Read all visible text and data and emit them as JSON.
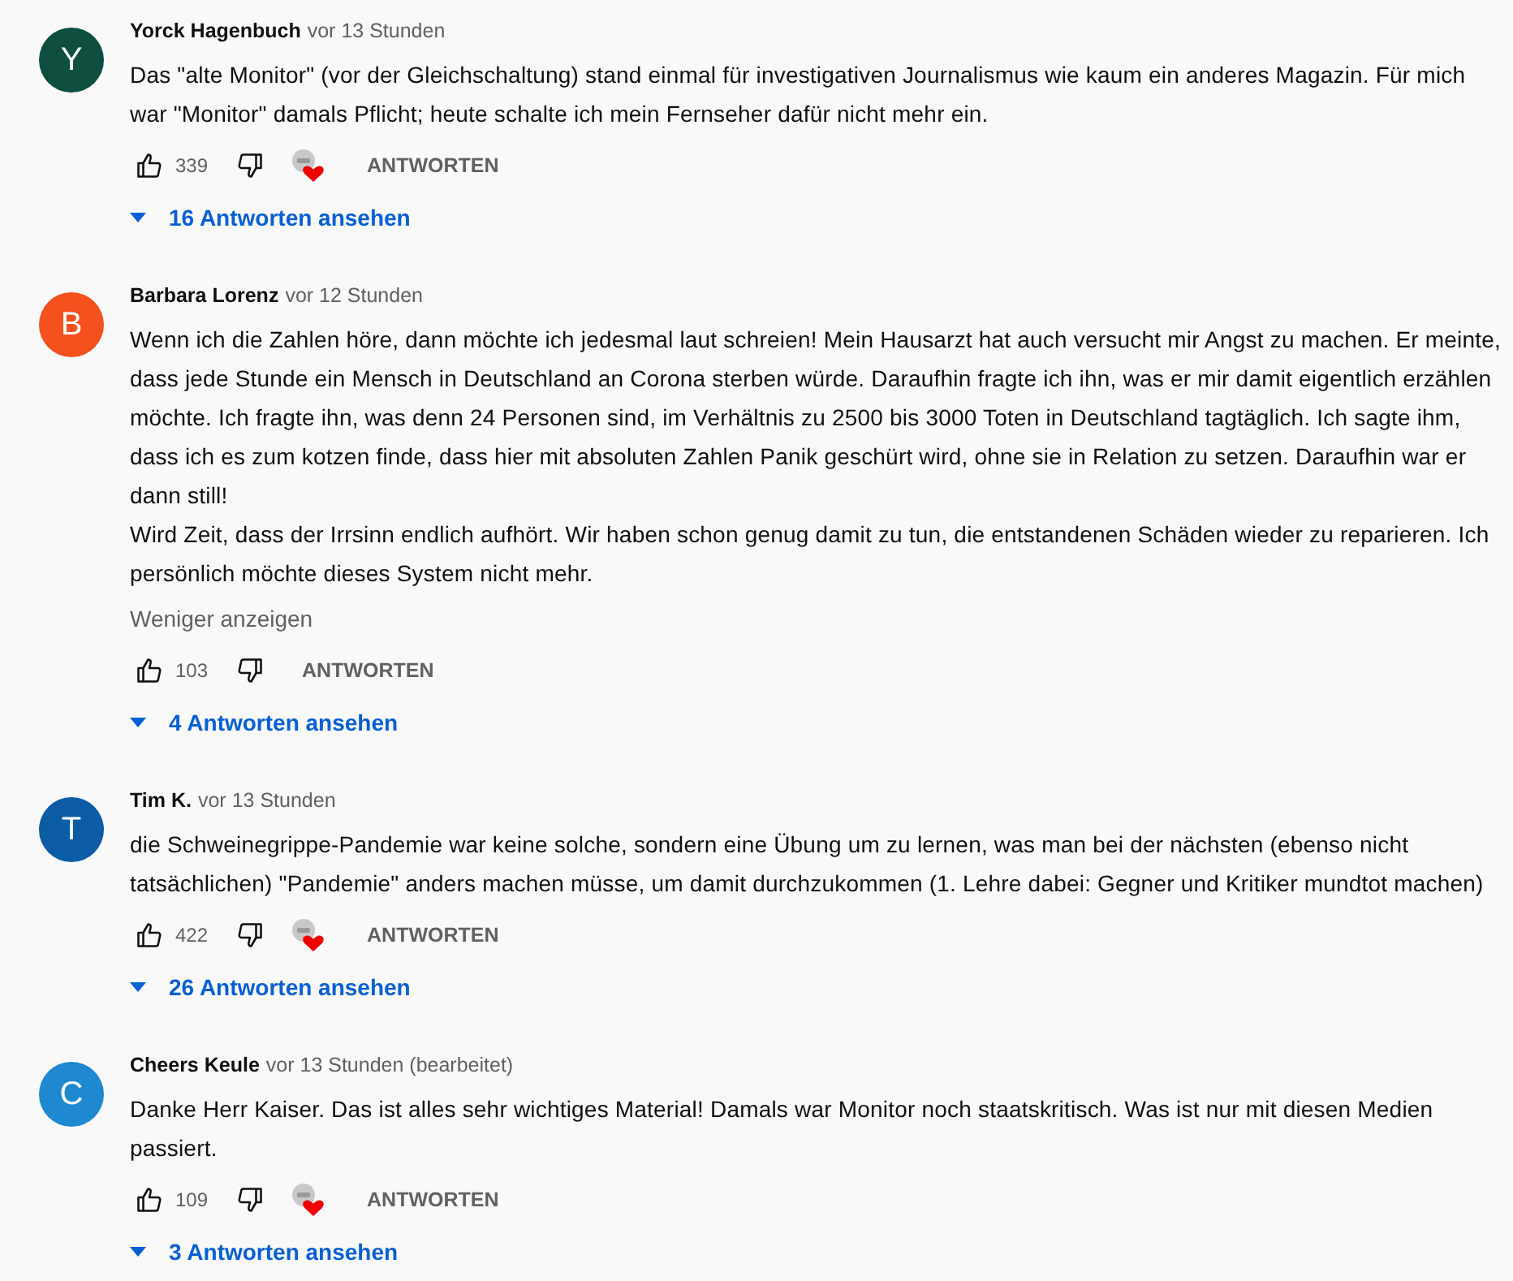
{
  "comments": [
    {
      "initial": "Y",
      "color": "#0f4e3f",
      "author": "Yorck Hagenbuch",
      "time": "vor 13 Stunden",
      "paragraphs": [
        "Das \"alte Monitor\" (vor der Gleichschaltung) stand einmal für investigativen Journalismus wie kaum ein anderes Magazin. Für mich war \"Monitor\" damals Pflicht; heute schalte ich mein Fernseher dafür nicht mehr ein."
      ],
      "likes": "339",
      "hearted": true,
      "reply": "ANTWORTEN",
      "replies": "16 Antworten ansehen"
    },
    {
      "initial": "B",
      "color": "#f4511e",
      "author": "Barbara Lorenz",
      "time": "vor 12 Stunden",
      "paragraphs": [
        "Wenn ich die Zahlen höre, dann möchte ich jedesmal laut schreien! Mein Hausarzt hat auch versucht mir Angst zu machen. Er meinte, dass jede Stunde ein Mensch in Deutschland an Corona sterben würde. Daraufhin fragte ich ihn, was er mir damit eigentlich erzählen möchte. Ich fragte ihn, was denn 24 Personen sind, im Verhältnis zu 2500 bis 3000 Toten in Deutschland tagtäglich. Ich sagte ihm, dass ich es zum kotzen finde, dass hier mit absoluten Zahlen Panik geschürt wird, ohne sie in Relation zu setzen. Daraufhin war er dann still!",
        "Wird Zeit, dass der Irrsinn endlich aufhört. Wir haben schon genug damit zu tun, die entstandenen Schäden wieder zu reparieren. Ich persönlich möchte dieses System nicht mehr."
      ],
      "show_less": "Weniger anzeigen",
      "likes": "103",
      "hearted": false,
      "reply": "ANTWORTEN",
      "replies": "4 Antworten ansehen"
    },
    {
      "initial": "T",
      "color": "#0b5ca5",
      "author": "Tim K.",
      "time": "vor 13 Stunden",
      "paragraphs": [
        "die Schweinegrippe-Pandemie war keine solche, sondern eine Übung um zu lernen, was man bei der nächsten (ebenso nicht tatsächlichen) \"Pandemie\" anders machen müsse, um damit durchzukommen (1. Lehre dabei: Gegner und Kritiker mundtot machen)"
      ],
      "likes": "422",
      "hearted": true,
      "reply": "ANTWORTEN",
      "replies": "26 Antworten ansehen"
    },
    {
      "initial": "C",
      "color": "#1e88d0",
      "author": "Cheers Keule",
      "time": "vor 13 Stunden (bearbeitet)",
      "paragraphs": [
        "Danke Herr Kaiser. Das ist alles sehr wichtiges Material! Damals war Monitor noch staatskritisch. Was ist nur mit diesen Medien passiert."
      ],
      "likes": "109",
      "hearted": true,
      "reply": "ANTWORTEN",
      "replies": "3 Antworten ansehen"
    }
  ]
}
